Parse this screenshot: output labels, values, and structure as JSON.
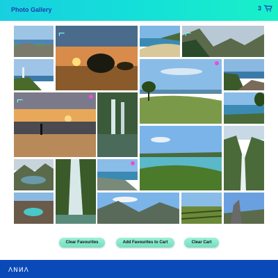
{
  "header": {
    "title": "Photo Gallery",
    "cart_count": "3"
  },
  "colors": {
    "accent": "#1a3fb0",
    "footer": "#0a49b8",
    "button": "#7fe6c8",
    "favourite": "#e84fd8"
  },
  "gallery": {
    "tiles": [
      {
        "name": "photo-rocky-coast",
        "fav": false,
        "mark": false
      },
      {
        "name": "photo-sunset-trees",
        "fav": false,
        "mark": true
      },
      {
        "name": "photo-beach-bay",
        "fav": false,
        "mark": false
      },
      {
        "name": "photo-mountain-ridge",
        "fav": false,
        "mark": true
      },
      {
        "name": "photo-lighthouse",
        "fav": false,
        "mark": false
      },
      {
        "name": "photo-green-hill-tree",
        "fav": true,
        "mark": false
      },
      {
        "name": "photo-coast-rocks",
        "fav": false,
        "mark": false
      },
      {
        "name": "photo-beach-sunset-person",
        "fav": true,
        "mark": true
      },
      {
        "name": "photo-waterfall-forest",
        "fav": false,
        "mark": false
      },
      {
        "name": "photo-blue-water-cove",
        "fav": false,
        "mark": false
      },
      {
        "name": "photo-lake-valley",
        "fav": false,
        "mark": false
      },
      {
        "name": "photo-harbour-bay",
        "fav": false,
        "mark": false
      },
      {
        "name": "photo-bay-islands",
        "fav": false,
        "mark": false
      },
      {
        "name": "photo-green-valley",
        "fav": false,
        "mark": false
      },
      {
        "name": "photo-mountain-lake",
        "fav": false,
        "mark": false
      },
      {
        "name": "photo-tall-waterfall",
        "fav": false,
        "mark": false
      },
      {
        "name": "photo-town-coast",
        "fav": true,
        "mark": false
      },
      {
        "name": "photo-mountain-range",
        "fav": false,
        "mark": false
      },
      {
        "name": "photo-vineyard",
        "fav": false,
        "mark": false
      },
      {
        "name": "photo-rock-monument",
        "fav": false,
        "mark": false
      },
      {
        "name": "photo-crater-lake",
        "fav": false,
        "mark": false
      }
    ]
  },
  "actions": {
    "clear_favourites": "Clear Favourites",
    "add_favourites": "Add Favourites to Cart",
    "clear_cart": "Clear Cart"
  },
  "footer": {
    "logo_alt": "brand-logo"
  }
}
